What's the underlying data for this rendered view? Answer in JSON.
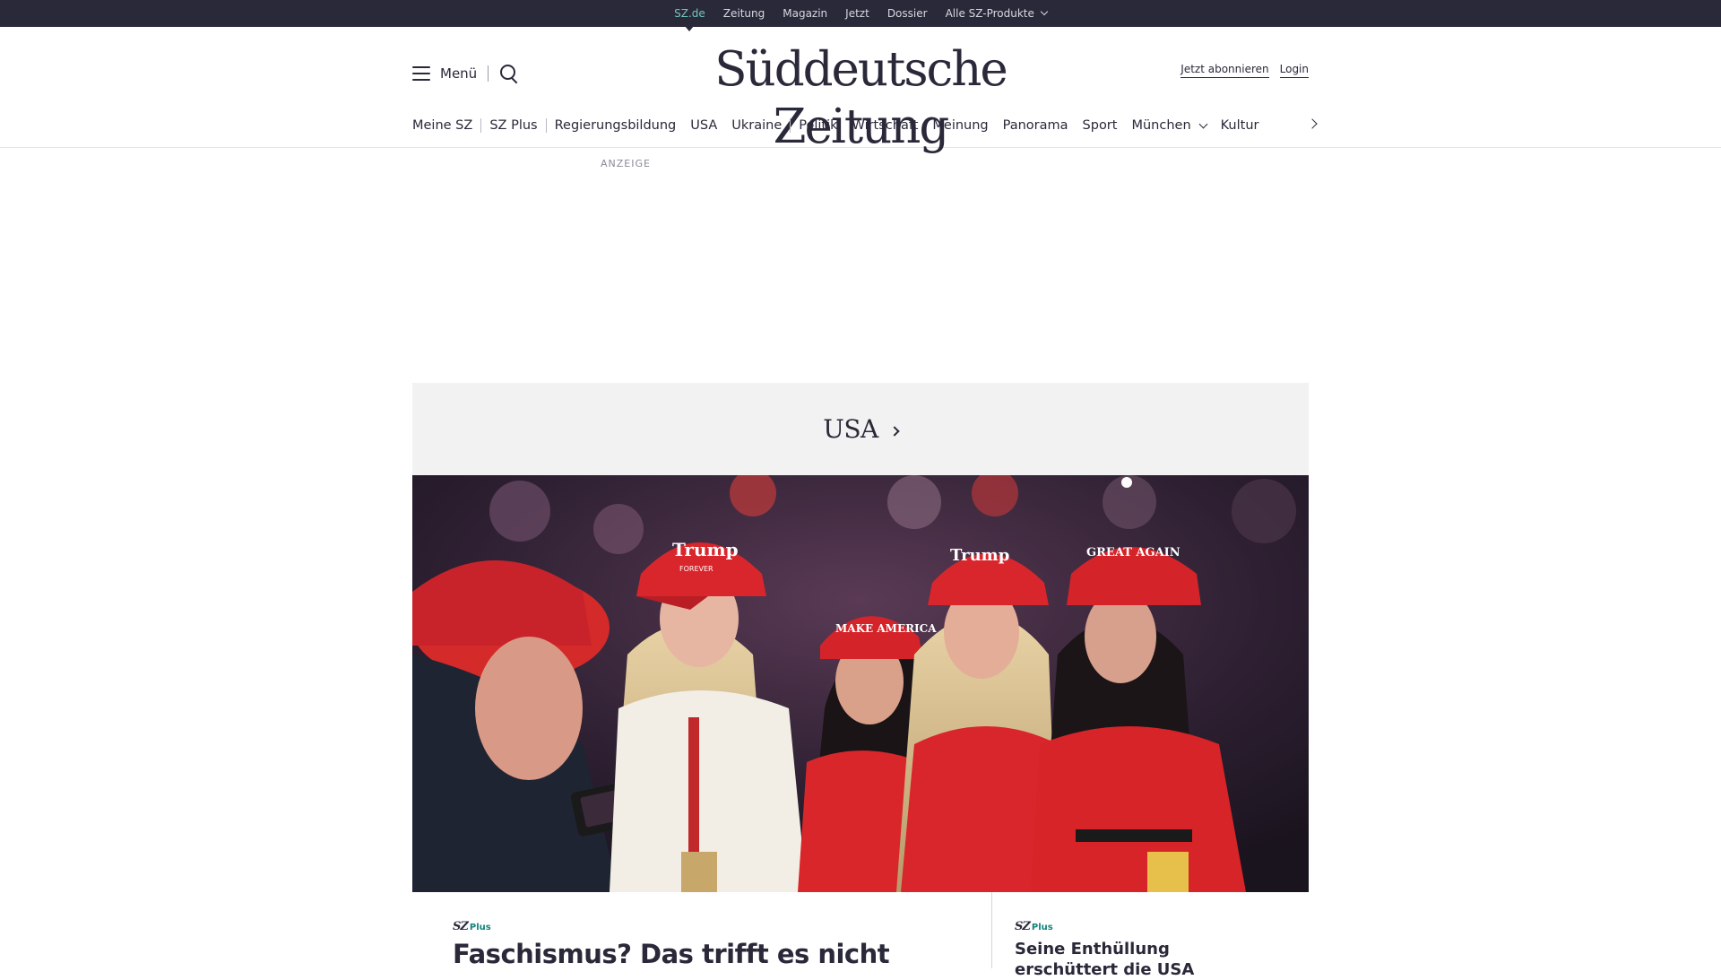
{
  "topbar": {
    "items": [
      {
        "label": "SZ.de",
        "active": true
      },
      {
        "label": "Zeitung"
      },
      {
        "label": "Magazin"
      },
      {
        "label": "Jetzt"
      },
      {
        "label": "Dossier"
      },
      {
        "label": "Alle SZ-Produkte",
        "dropdown": true
      }
    ]
  },
  "header": {
    "menu_label": "Menü",
    "logo_text": "Süddeutsche Zeitung",
    "subscribe_label": "Jetzt abonnieren",
    "login_label": "Login"
  },
  "nav": {
    "items": [
      "Meine SZ",
      "SZ Plus",
      "Regierungsbildung",
      "USA",
      "Ukraine",
      "Politik",
      "Wirtschaft",
      "Meinung",
      "Panorama",
      "Sport",
      "München",
      "Kultur"
    ]
  },
  "ad": {
    "label": "ANZEIGE"
  },
  "section": {
    "title": "USA"
  },
  "hero": {
    "cap_texts": [
      "Trump",
      "FOREVER",
      "MAKE AMERICA",
      "GREAT AGAIN",
      "Trump"
    ]
  },
  "teaser": {
    "main": {
      "badge_sz": "SZ",
      "badge_plus": "Plus",
      "headline": "Faschismus? Das trifft es nicht"
    },
    "side": {
      "badge_sz": "SZ",
      "badge_plus": "Plus",
      "headline": "Seine Enthüllung erschüttert die USA"
    }
  },
  "colors": {
    "dark": "#29293a",
    "accent_teal": "#71c6bc",
    "plus_green": "#11847a",
    "banner_gray": "#f2f2f2"
  }
}
